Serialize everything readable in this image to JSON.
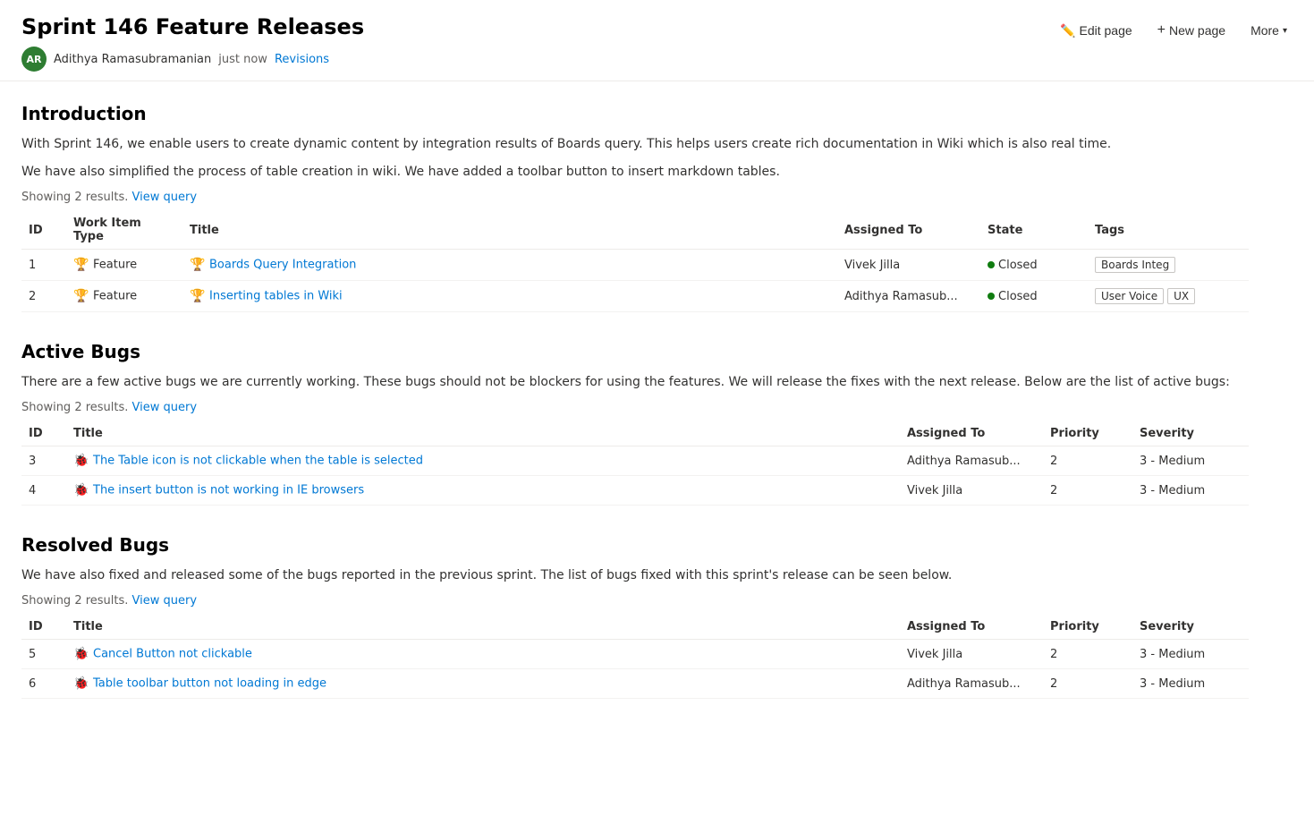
{
  "page": {
    "title": "Sprint 146 Feature Releases",
    "author": {
      "initials": "AR",
      "name": "Adithya Ramasubramanian",
      "timestamp": "just now",
      "avatar_color": "#2e7d32"
    },
    "revisions_label": "Revisions",
    "toolbar": {
      "edit_label": "Edit page",
      "new_label": "New page",
      "more_label": "More"
    }
  },
  "introduction": {
    "heading": "Introduction",
    "para1": "With Sprint 146, we enable users to create dynamic content by integration results of Boards query. This helps users create rich documentation in Wiki which is also real time.",
    "para2": "We have also simplified the process of table creation in wiki. We have added a toolbar button to insert markdown tables.",
    "showing": "Showing 2 results.",
    "view_query": "View query",
    "table": {
      "columns": [
        "ID",
        "Work Item Type",
        "Title",
        "Assigned To",
        "State",
        "Tags"
      ],
      "rows": [
        {
          "id": "1",
          "type": "Feature",
          "title": "Boards Query Integration",
          "assigned_to": "Vivek Jilla",
          "state": "Closed",
          "tags": [
            "Boards Integ"
          ]
        },
        {
          "id": "2",
          "type": "Feature",
          "title": "Inserting tables in Wiki",
          "assigned_to": "Adithya Ramasub...",
          "state": "Closed",
          "tags": [
            "User Voice",
            "UX"
          ]
        }
      ]
    }
  },
  "active_bugs": {
    "heading": "Active Bugs",
    "para": "There are a few active bugs we are currently working. These bugs should not be blockers for using the features. We will release the fixes with the next release. Below are the list of active bugs:",
    "showing": "Showing 2 results.",
    "view_query": "View query",
    "table": {
      "columns": [
        "ID",
        "Title",
        "Assigned To",
        "Priority",
        "Severity"
      ],
      "rows": [
        {
          "id": "3",
          "title": "The Table icon is not clickable when the table is selected",
          "assigned_to": "Adithya Ramasub...",
          "priority": "2",
          "severity": "3 - Medium"
        },
        {
          "id": "4",
          "title": "The insert button is not working in IE browsers",
          "assigned_to": "Vivek Jilla",
          "priority": "2",
          "severity": "3 - Medium"
        }
      ]
    }
  },
  "resolved_bugs": {
    "heading": "Resolved Bugs",
    "para": "We have also fixed and released some of the bugs reported in the previous sprint. The list of bugs fixed with this sprint's release can be seen below.",
    "showing": "Showing 2 results.",
    "view_query": "View query",
    "table": {
      "columns": [
        "ID",
        "Title",
        "Assigned To",
        "Priority",
        "Severity"
      ],
      "rows": [
        {
          "id": "5",
          "title": "Cancel Button not clickable",
          "assigned_to": "Vivek Jilla",
          "priority": "2",
          "severity": "3 - Medium"
        },
        {
          "id": "6",
          "title": "Table toolbar button not loading in edge",
          "assigned_to": "Adithya Ramasub...",
          "priority": "2",
          "severity": "3 - Medium"
        }
      ]
    }
  }
}
